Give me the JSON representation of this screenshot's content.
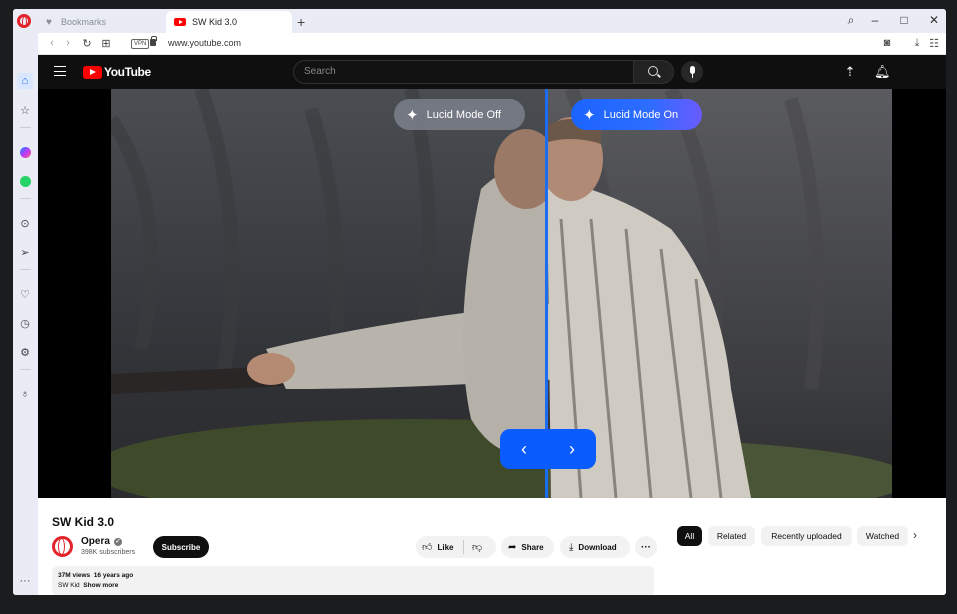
{
  "browser": {
    "tabs": [
      {
        "label": "Bookmarks",
        "icon": "heart-icon"
      },
      {
        "label": "SW Kid 3.0",
        "icon": "youtube-icon"
      }
    ],
    "new_tab": "+",
    "url": "www.youtube.com",
    "vpn_badge": "VPN"
  },
  "youtube": {
    "logo_text": "YouTube",
    "search_placeholder": "Search"
  },
  "video": {
    "lucid_off": "Lucid Mode Off",
    "lucid_on": "Lucid Mode On",
    "prev_arrow": "‹",
    "next_arrow": "›",
    "title": "SW Kid 3.0"
  },
  "channel": {
    "name": "Opera",
    "subscribers": "398K subscribers",
    "subscribe": "Subscribe"
  },
  "actions": {
    "like": "Like",
    "share": "Share",
    "download": "Download",
    "more": "···"
  },
  "description": {
    "views": "37M views",
    "age": "16 years ago",
    "text": "SW Kid",
    "show_more": "Show more"
  },
  "chips": [
    "All",
    "Related",
    "Recently uploaded",
    "Watched"
  ],
  "colors": {
    "lucid_blue": "#0b5cff",
    "youtube_red": "#ff0000",
    "opera_red": "#e2232a"
  }
}
